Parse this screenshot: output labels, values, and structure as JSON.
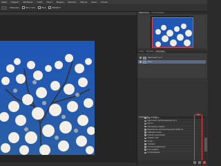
{
  "menubar": {
    "items": [
      "Файл",
      "Редакт",
      "Изображ",
      "Слой",
      "Текст",
      "Выдел",
      "Фильтр",
      "Просм",
      "Окно",
      "Справ"
    ]
  },
  "optionsbar": {
    "sample_label": "Образец:",
    "option1": "Все слои",
    "option2": "Вид",
    "option3": "Эффект"
  },
  "navigator": {
    "tabs": [
      "Навигатор",
      "Гистограмма"
    ]
  },
  "layers": {
    "tabs": [
      "Слои",
      "Каналы",
      "Контуры"
    ],
    "rows": [
      {
        "label": "Цветовой тон 1"
      },
      {
        "label": "Фон",
        "selected": true
      }
    ]
  },
  "history": {
    "tabs": [
      "Операции",
      "Стили"
    ],
    "items": [
      {
        "label": "Цвет ячейки"
      },
      {
        "label": "Цветовой тон/Насыщенность 1"
      },
      {
        "label": "Кисть"
      },
      {
        "label": "Настройка ячейки"
      },
      {
        "label": "Выделение дополнительной области"
      },
      {
        "label": "Обводка ячеек"
      },
      {
        "label": "Режим наложения"
      },
      {
        "label": "Новый слой"
      },
      {
        "label": "Слой 1"
      },
      {
        "label": "Заливка"
      },
      {
        "label": "Снятие выделения"
      },
      {
        "label": "Растушевка"
      },
      {
        "label": "Копирование"
      }
    ]
  },
  "colors": {
    "accent_selected": "#596a82",
    "highlight_red": "#e34141",
    "sky": "#1e4fa3"
  }
}
